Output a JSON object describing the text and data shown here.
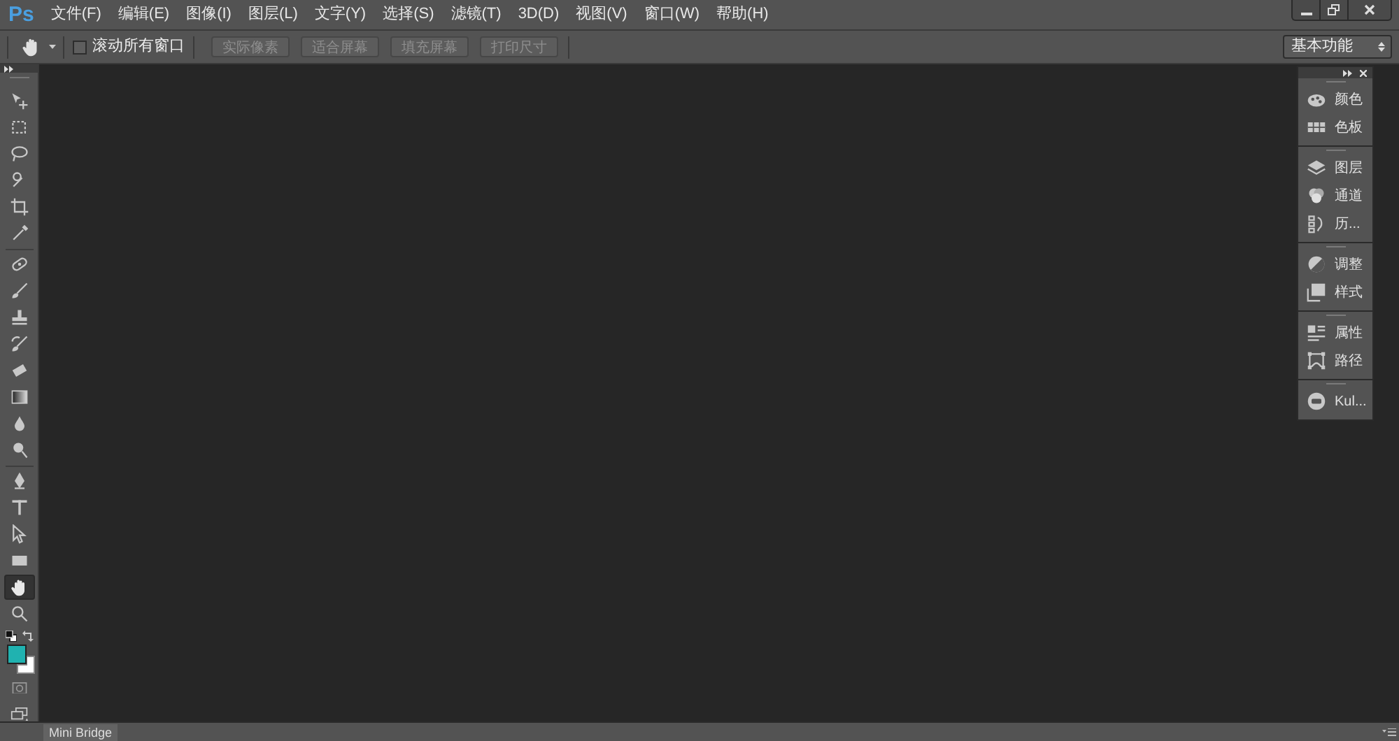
{
  "app_logo": "Ps",
  "menu": [
    "文件(F)",
    "编辑(E)",
    "图像(I)",
    "图层(L)",
    "文字(Y)",
    "选择(S)",
    "滤镜(T)",
    "3D(D)",
    "视图(V)",
    "窗口(W)",
    "帮助(H)"
  ],
  "options_bar": {
    "scroll_all": {
      "label": "滚动所有窗口",
      "checked": false
    },
    "buttons": [
      {
        "label": "实际像素",
        "disabled": true
      },
      {
        "label": "适合屏幕",
        "disabled": true
      },
      {
        "label": "填充屏幕",
        "disabled": true
      },
      {
        "label": "打印尺寸",
        "disabled": true
      }
    ],
    "workspace": "基本功能"
  },
  "tool_groups": [
    [
      {
        "kind": "move",
        "selected": false
      },
      {
        "kind": "marquee",
        "selected": false
      },
      {
        "kind": "lasso",
        "selected": false
      },
      {
        "kind": "quick-select",
        "selected": false
      },
      {
        "kind": "crop",
        "selected": false
      },
      {
        "kind": "eyedropper",
        "selected": false
      }
    ],
    [
      {
        "kind": "healing",
        "selected": false
      },
      {
        "kind": "brush",
        "selected": false
      },
      {
        "kind": "stamp",
        "selected": false
      },
      {
        "kind": "history-brush",
        "selected": false
      },
      {
        "kind": "eraser",
        "selected": false
      },
      {
        "kind": "gradient",
        "selected": false
      },
      {
        "kind": "blur",
        "selected": false
      },
      {
        "kind": "dodge",
        "selected": false
      }
    ],
    [
      {
        "kind": "pen",
        "selected": false
      },
      {
        "kind": "type",
        "selected": false
      },
      {
        "kind": "path-select",
        "selected": false
      },
      {
        "kind": "rectangle",
        "selected": false
      },
      {
        "kind": "hand",
        "selected": true
      },
      {
        "kind": "zoom",
        "selected": false
      }
    ]
  ],
  "colors": {
    "foreground": {
      "color": "#20b2b0"
    },
    "background": {
      "color": "#ffffff"
    }
  },
  "panel_groups": [
    [
      {
        "kind": "color",
        "label": "颜色"
      },
      {
        "kind": "swatches",
        "label": "色板"
      }
    ],
    [
      {
        "kind": "layers",
        "label": "图层"
      },
      {
        "kind": "channels",
        "label": "通道"
      },
      {
        "kind": "history",
        "label": "历..."
      }
    ],
    [
      {
        "kind": "adjustments",
        "label": "调整"
      },
      {
        "kind": "styles",
        "label": "样式"
      }
    ],
    [
      {
        "kind": "properties",
        "label": "属性"
      },
      {
        "kind": "paths",
        "label": "路径"
      }
    ],
    [
      {
        "kind": "kuler",
        "label": "Kul..."
      }
    ]
  ],
  "bottom_tab": "Mini Bridge"
}
